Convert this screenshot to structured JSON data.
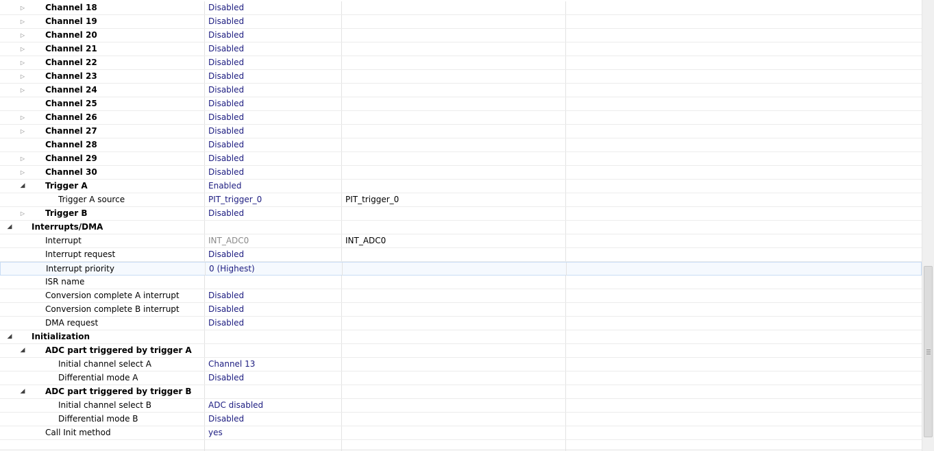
{
  "rows": [
    {
      "name": "Channel 18",
      "value": "Disabled",
      "details": "",
      "level": 1,
      "bold": true,
      "expander": "closed"
    },
    {
      "name": "Channel 19",
      "value": "Disabled",
      "details": "",
      "level": 1,
      "bold": true,
      "expander": "closed"
    },
    {
      "name": "Channel 20",
      "value": "Disabled",
      "details": "",
      "level": 1,
      "bold": true,
      "expander": "closed"
    },
    {
      "name": "Channel 21",
      "value": "Disabled",
      "details": "",
      "level": 1,
      "bold": true,
      "expander": "closed"
    },
    {
      "name": "Channel 22",
      "value": "Disabled",
      "details": "",
      "level": 1,
      "bold": true,
      "expander": "closed"
    },
    {
      "name": "Channel 23",
      "value": "Disabled",
      "details": "",
      "level": 1,
      "bold": true,
      "expander": "closed"
    },
    {
      "name": "Channel 24",
      "value": "Disabled",
      "details": "",
      "level": 1,
      "bold": true,
      "expander": "closed"
    },
    {
      "name": "Channel 25",
      "value": "Disabled",
      "details": "",
      "level": 1,
      "bold": true,
      "expander": "none"
    },
    {
      "name": "Channel 26",
      "value": "Disabled",
      "details": "",
      "level": 1,
      "bold": true,
      "expander": "closed"
    },
    {
      "name": "Channel 27",
      "value": "Disabled",
      "details": "",
      "level": 1,
      "bold": true,
      "expander": "closed"
    },
    {
      "name": "Channel 28",
      "value": "Disabled",
      "details": "",
      "level": 1,
      "bold": true,
      "expander": "none"
    },
    {
      "name": "Channel 29",
      "value": "Disabled",
      "details": "",
      "level": 1,
      "bold": true,
      "expander": "closed"
    },
    {
      "name": "Channel 30",
      "value": "Disabled",
      "details": "",
      "level": 1,
      "bold": true,
      "expander": "closed"
    },
    {
      "name": "Trigger A",
      "value": "Enabled",
      "details": "",
      "level": 1,
      "bold": true,
      "expander": "open"
    },
    {
      "name": "Trigger A source",
      "value": "PIT_trigger_0",
      "details": "PIT_trigger_0",
      "level": 2,
      "bold": false,
      "expander": "none"
    },
    {
      "name": "Trigger B",
      "value": "Disabled",
      "details": "",
      "level": 1,
      "bold": true,
      "expander": "closed"
    },
    {
      "name": "Interrupts/DMA",
      "value": "",
      "details": "",
      "level": 0,
      "bold": true,
      "expander": "open"
    },
    {
      "name": "Interrupt",
      "value": "INT_ADC0",
      "details": "INT_ADC0",
      "level": 1,
      "bold": false,
      "expander": "none",
      "greyValue": true
    },
    {
      "name": "Interrupt request",
      "value": "Disabled",
      "details": "",
      "level": 1,
      "bold": false,
      "expander": "none"
    },
    {
      "name": "Interrupt priority",
      "value": "0 (Highest)",
      "details": "",
      "level": 1,
      "bold": false,
      "expander": "none",
      "selected": true
    },
    {
      "name": "ISR name",
      "value": "",
      "details": "",
      "level": 1,
      "bold": false,
      "expander": "none"
    },
    {
      "name": "Conversion complete A interrupt",
      "value": "Disabled",
      "details": "",
      "level": 1,
      "bold": false,
      "expander": "none"
    },
    {
      "name": "Conversion complete B interrupt",
      "value": "Disabled",
      "details": "",
      "level": 1,
      "bold": false,
      "expander": "none"
    },
    {
      "name": "DMA request",
      "value": "Disabled",
      "details": "",
      "level": 1,
      "bold": false,
      "expander": "none"
    },
    {
      "name": "Initialization",
      "value": "",
      "details": "",
      "level": 0,
      "bold": true,
      "expander": "open"
    },
    {
      "name": "ADC part triggered  by trigger A",
      "value": "",
      "details": "",
      "level": 1,
      "bold": true,
      "expander": "open"
    },
    {
      "name": "Initial channel select A",
      "value": "Channel 13",
      "details": "",
      "level": 2,
      "bold": false,
      "expander": "none"
    },
    {
      "name": "Differential mode A",
      "value": "Disabled",
      "details": "",
      "level": 2,
      "bold": false,
      "expander": "none"
    },
    {
      "name": "ADC part triggered  by trigger B",
      "value": "",
      "details": "",
      "level": 1,
      "bold": true,
      "expander": "open"
    },
    {
      "name": "Initial channel select B",
      "value": "ADC disabled",
      "details": "",
      "level": 2,
      "bold": false,
      "expander": "none"
    },
    {
      "name": "Differential mode B",
      "value": "Disabled",
      "details": "",
      "level": 2,
      "bold": false,
      "expander": "none"
    },
    {
      "name": "Call Init method",
      "value": "yes",
      "details": "",
      "level": 1,
      "bold": false,
      "expander": "none"
    }
  ],
  "icons": {
    "closed": "▷",
    "open": "◢"
  },
  "scrollbar": {
    "position_fraction": 0.59,
    "visible_fraction": 0.38
  }
}
